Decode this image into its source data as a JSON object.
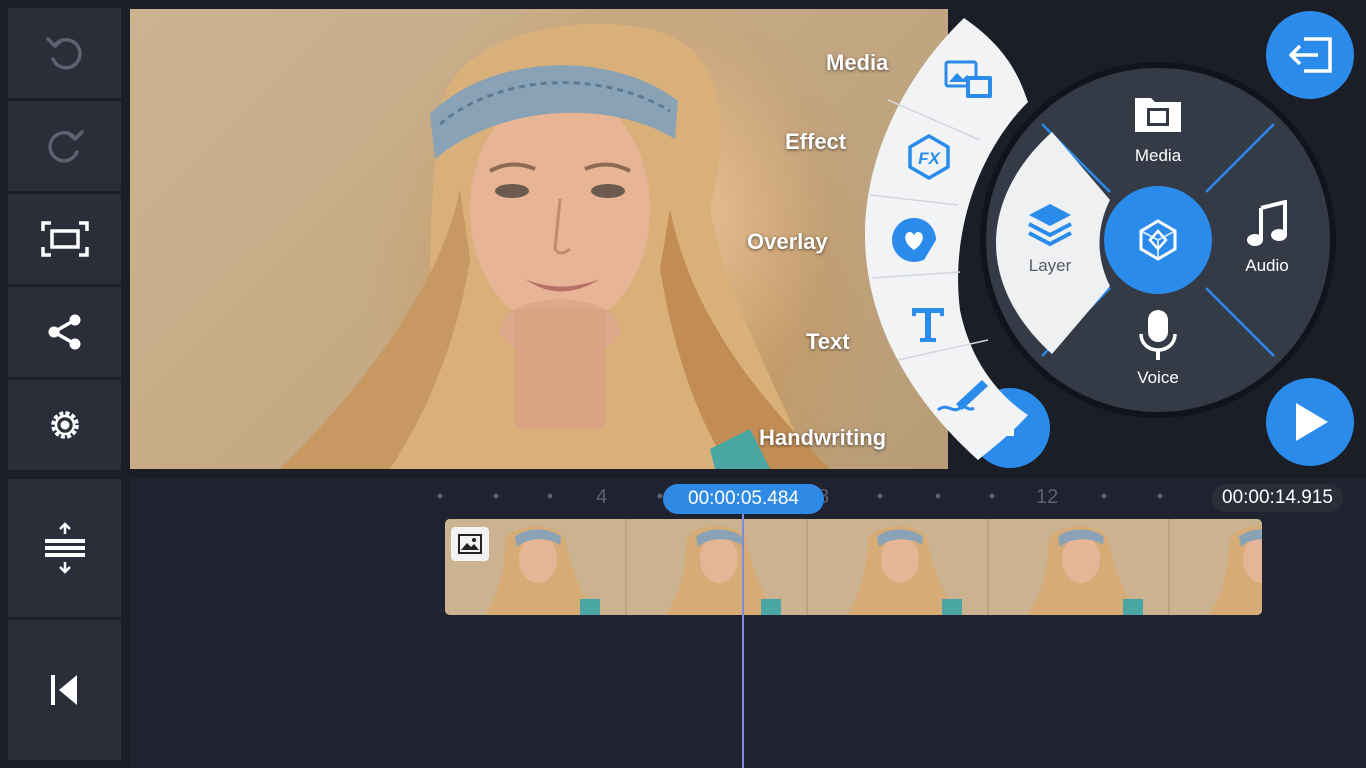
{
  "toolbar": {
    "items": [
      {
        "name": "undo-icon"
      },
      {
        "name": "redo-icon"
      },
      {
        "name": "fullscreen-icon"
      },
      {
        "name": "share-icon"
      },
      {
        "name": "settings-gear-icon"
      },
      {
        "name": "timeline-expand-icon"
      },
      {
        "name": "skip-to-start-icon"
      }
    ]
  },
  "fan_menu": {
    "items": [
      {
        "label": "Media",
        "icon": "media-image-icon"
      },
      {
        "label": "Effect",
        "icon": "fx-icon"
      },
      {
        "label": "Overlay",
        "icon": "sticker-heart-icon"
      },
      {
        "label": "Text",
        "icon": "text-t-icon"
      },
      {
        "label": "Handwriting",
        "icon": "pen-icon"
      }
    ]
  },
  "main_menu": {
    "media": "Media",
    "audio": "Audio",
    "voice": "Voice",
    "layer": "Layer"
  },
  "timeline": {
    "current_time": "00:00:05.484",
    "total_time": "00:00:14.915",
    "ruler_labels": [
      "4",
      "8",
      "12"
    ]
  },
  "colors": {
    "accent": "#2a8bea",
    "panel": "#2a2e38",
    "background": "#1b1e27",
    "ring": "#343a46"
  }
}
